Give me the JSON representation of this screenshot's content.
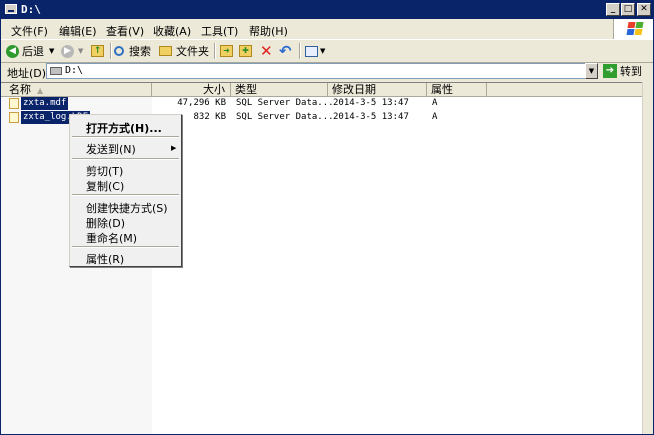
{
  "window": {
    "title": "D:\\"
  },
  "menu": [
    "文件(F)",
    "编辑(E)",
    "查看(V)",
    "收藏(A)",
    "工具(T)",
    "帮助(H)"
  ],
  "toolbar": {
    "back": "后退",
    "search": "搜索",
    "folders": "文件夹"
  },
  "address": {
    "label": "地址(D)",
    "value": "D:\\",
    "go": "转到"
  },
  "columns": {
    "name": "名称",
    "size": "大小",
    "type": "类型",
    "modified": "修改日期",
    "attributes": "属性"
  },
  "files": [
    {
      "name": "zxta.mdf",
      "size": "47,296 KB",
      "type": "SQL Server Data...",
      "modified": "2014-3-5 13:47",
      "attr": "A"
    },
    {
      "name": "zxta_log.LDF",
      "size": "832 KB",
      "type": "SQL Server Data...",
      "modified": "2014-3-5 13:47",
      "attr": "A"
    }
  ],
  "context_menu": {
    "open_with": "打开方式(H)...",
    "send_to": "发送到(N)",
    "cut": "剪切(T)",
    "copy": "复制(C)",
    "create_shortcut": "创建快捷方式(S)",
    "delete": "删除(D)",
    "rename": "重命名(M)",
    "properties": "属性(R)"
  }
}
